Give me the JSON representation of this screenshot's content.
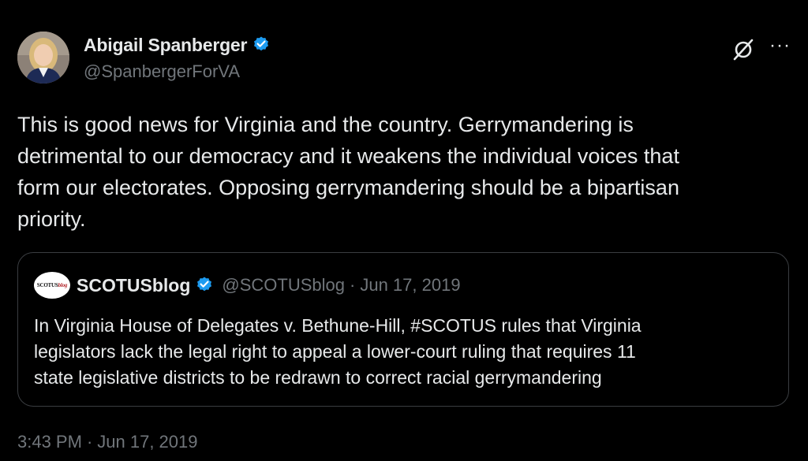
{
  "author": {
    "display_name": "Abigail Spanberger",
    "handle": "@SpanbergerForVA",
    "verified": true,
    "avatar_icon": "profile-photo"
  },
  "actions": {
    "grok_icon": "grok-icon",
    "more_label": "···"
  },
  "tweet": {
    "text": "This is good news for Virginia and the country. Gerrymandering is\ndetrimental to our democracy and it weakens the individual voices that\nform our electorates. Opposing gerrymandering should be a bipartisan\npriority."
  },
  "quote": {
    "avatar_text_main": "SCOTUS",
    "avatar_text_accent": "blog",
    "display_name": "SCOTUSblog",
    "handle": "@SCOTUSblog",
    "separator": "·",
    "date": "Jun 17, 2019",
    "verified": true,
    "text": "In Virginia House of Delegates v. Bethune-Hill, #SCOTUS rules that Virginia\nlegislators lack the legal right to appeal a lower-court ruling that requires 11\nstate legislative districts to be redrawn to correct racial gerrymandering"
  },
  "footer": {
    "time": "3:43 PM",
    "separator": "·",
    "date": "Jun 17, 2019"
  },
  "colors": {
    "background": "#000000",
    "text_primary": "#e7e9ea",
    "text_secondary": "#71767b",
    "verified_blue": "#1d9bf0",
    "border": "#3a3d41"
  }
}
